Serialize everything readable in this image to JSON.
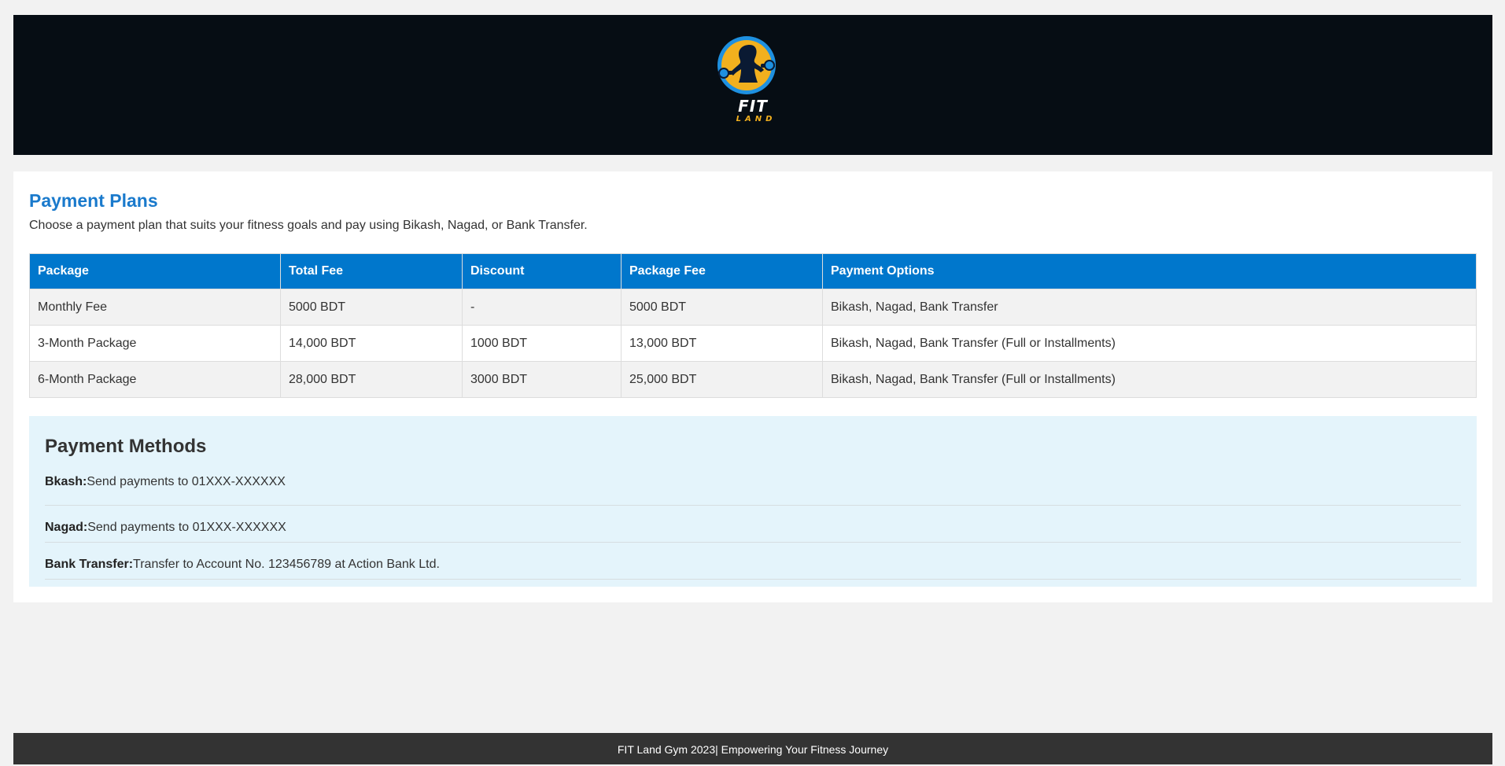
{
  "brand": {
    "logo_name": "FIT",
    "logo_sub": "LAND",
    "logo_colors": {
      "ring": "#1e90e0",
      "sun": "#f2b01e",
      "figure": "#0a1a33"
    }
  },
  "plans": {
    "title": "Payment Plans",
    "description": "Choose a payment plan that suits your fitness goals and pay using Bikash, Nagad, or Bank Transfer.",
    "columns": [
      "Package",
      "Total Fee",
      "Discount",
      "Package Fee",
      "Payment Options"
    ],
    "rows": [
      [
        "Monthly Fee",
        "5000 BDT",
        "-",
        "5000 BDT",
        "Bikash, Nagad, Bank Transfer"
      ],
      [
        "3-Month Package",
        "14,000 BDT",
        "1000 BDT",
        "13,000 BDT",
        "Bikash, Nagad, Bank Transfer (Full or Installments)"
      ],
      [
        "6-Month Package",
        "28,000 BDT",
        "3000 BDT",
        "25,000 BDT",
        "Bikash, Nagad, Bank Transfer (Full or Installments)"
      ]
    ]
  },
  "methods": {
    "title": "Payment Methods",
    "items": [
      {
        "label": "Bkash:",
        "text": "Send payments to 01XXX-XXXXXX"
      },
      {
        "label": "Nagad:",
        "text": "Send payments to 01XXX-XXXXXX"
      },
      {
        "label": "Bank Transfer:",
        "text": "Transfer to Account No. 123456789 at Action Bank Ltd."
      }
    ]
  },
  "footer": {
    "text": "FIT Land Gym 2023| Empowering Your Fitness Journey"
  },
  "colors": {
    "accent": "#0077cc",
    "title": "#1a7acc",
    "header_bg": "#060d14",
    "methods_bg": "#e4f4fb",
    "footer_bg": "#333333"
  }
}
